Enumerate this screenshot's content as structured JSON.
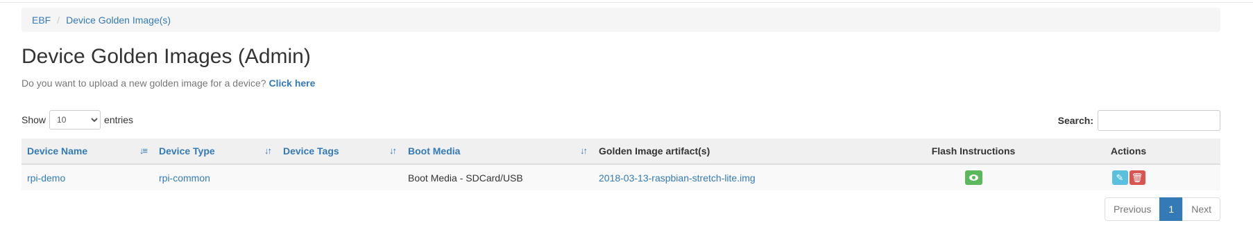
{
  "breadcrumb": {
    "items": [
      "EBF",
      "Device Golden Image(s)"
    ],
    "separator": "/"
  },
  "page": {
    "title": "Device Golden Images (Admin)",
    "intro_text": "Do you want to upload a new golden image for a device?",
    "intro_link": "Click here"
  },
  "length_control": {
    "prefix": "Show",
    "selected": "10",
    "suffix": "entries"
  },
  "search": {
    "label": "Search:",
    "value": ""
  },
  "table": {
    "columns": [
      {
        "label": "Device Name",
        "sortable": true,
        "sort_state": "ascending"
      },
      {
        "label": "Device Type",
        "sortable": true,
        "sort_state": "none"
      },
      {
        "label": "Device Tags",
        "sortable": true,
        "sort_state": "none"
      },
      {
        "label": "Boot Media",
        "sortable": true,
        "sort_state": "none"
      },
      {
        "label": "Golden Image artifact(s)",
        "sortable": false
      },
      {
        "label": "Flash Instructions",
        "sortable": false
      },
      {
        "label": "Actions",
        "sortable": false
      }
    ],
    "rows": [
      {
        "device_name": "rpi-demo",
        "device_type": "rpi-common",
        "device_tags": "",
        "boot_media": "Boot Media - SDCard/USB",
        "artifact": "2018-03-13-raspbian-stretch-lite.img",
        "flash_icon": "eye-icon",
        "actions": [
          "pencil-icon",
          "trash-icon"
        ]
      }
    ]
  },
  "pagination": {
    "previous": "Previous",
    "current": "1",
    "next": "Next"
  },
  "colors": {
    "link": "#337ab7",
    "success": "#5cb85c",
    "info": "#5bc0de",
    "danger": "#d9534f"
  }
}
